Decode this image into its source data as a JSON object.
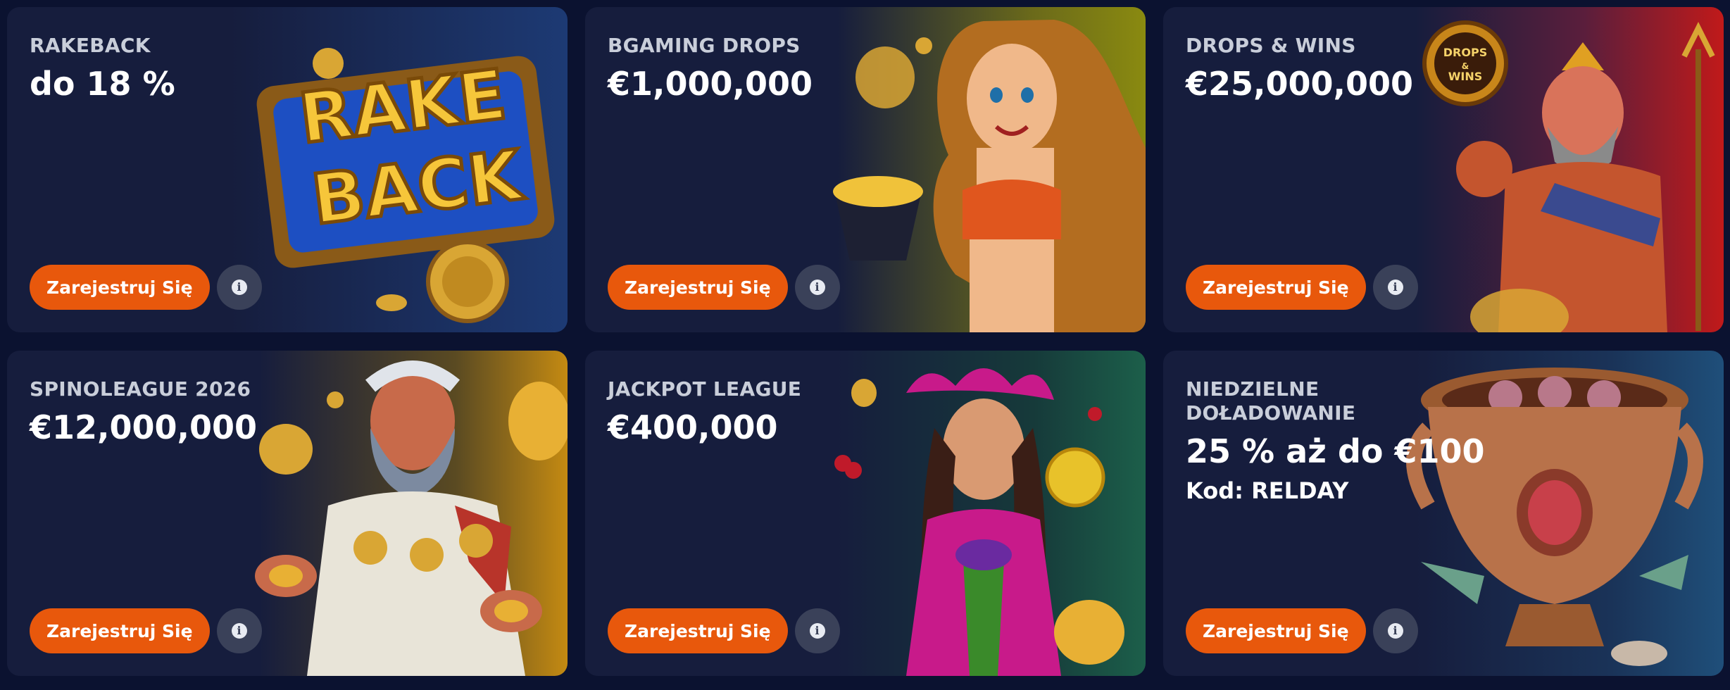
{
  "promos": [
    {
      "label": "RAKEBACK",
      "value": "do 18 %",
      "art": "rakeback-chest-art",
      "button": "Zarejestruj Się",
      "accent": "#2a4a8f"
    },
    {
      "label": "BGAMING DROPS",
      "value": "€1,000,000",
      "art": "golden-goddess-art",
      "button": "Zarejestruj Się",
      "accent": "#a07c10"
    },
    {
      "label": "DROPS & WINS",
      "value": "€25,000,000",
      "art": "neptune-warrior-art",
      "button": "Zarejestruj Się",
      "accent": "#b31c1c"
    },
    {
      "label": "SPINOLEAGUE 2026",
      "value": "€12,000,000",
      "art": "zeus-coins-art",
      "button": "Zarejestruj Się",
      "accent": "#c48a12"
    },
    {
      "label": "JACKPOT LEAGUE",
      "value": "€400,000",
      "art": "jester-girl-art",
      "button": "Zarejestruj Się",
      "accent": "#1c5f4a"
    },
    {
      "label": "NIEDZIELNE DOŁADOWANIE",
      "value": "25 % aż do €100",
      "code": "Kod: RELDAY",
      "art": "golden-cup-art",
      "button": "Zarejestruj Się",
      "accent": "#1f4f7a"
    }
  ],
  "art_labels": {
    "rakeback": [
      "RAKE",
      "BACK"
    ],
    "drops_badge": [
      "DROPS",
      "&",
      "WINS"
    ]
  }
}
